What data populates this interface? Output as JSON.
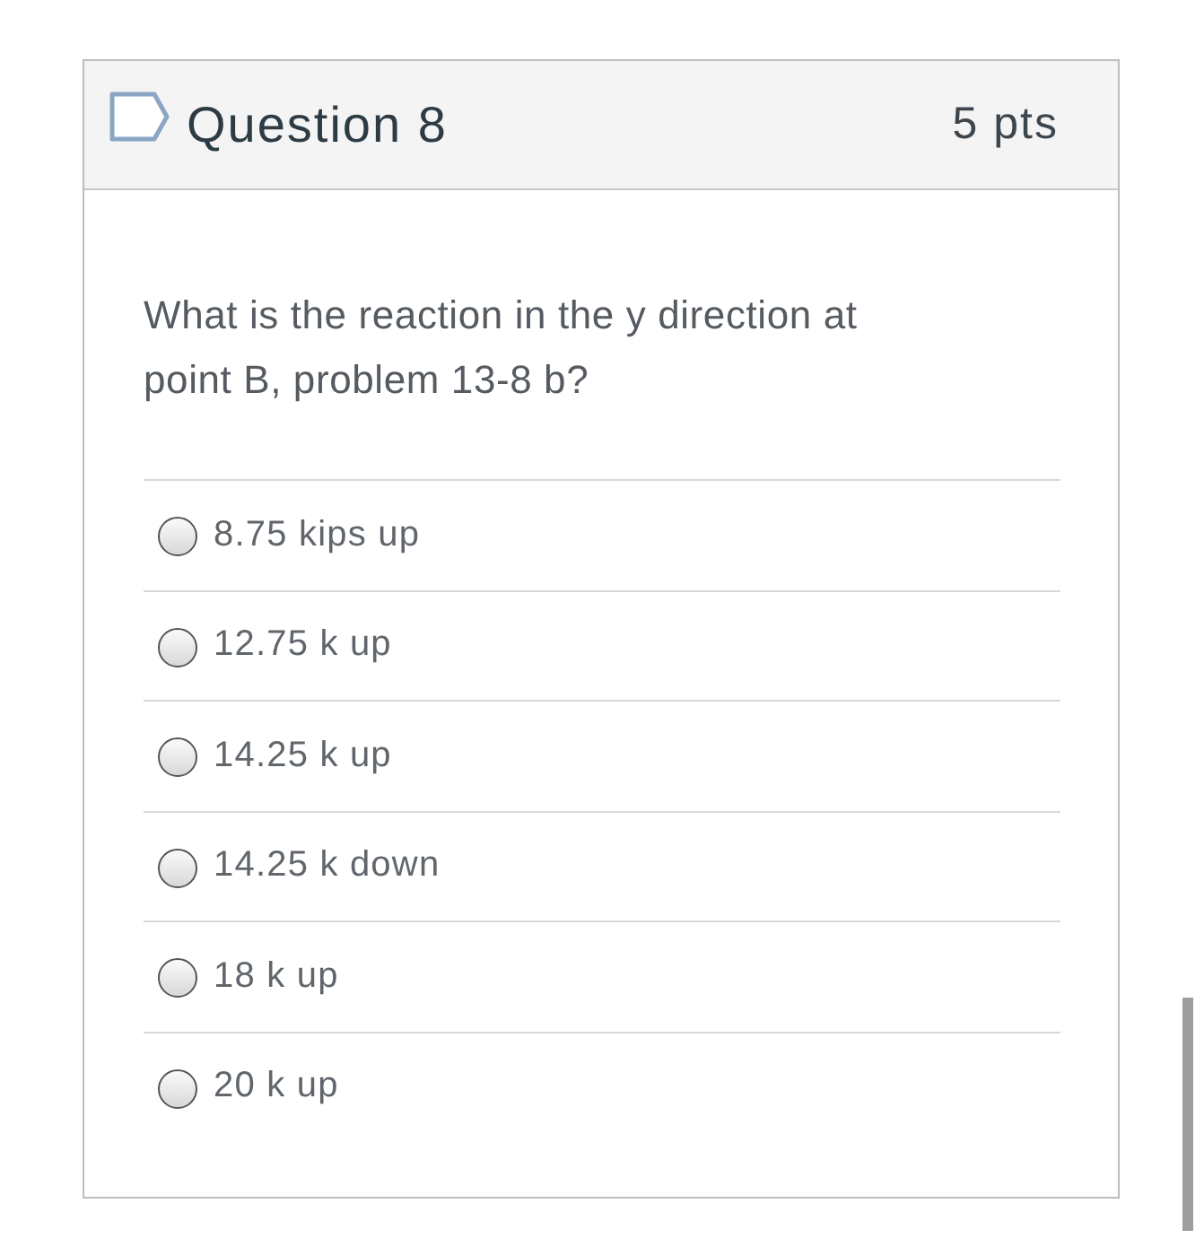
{
  "question": {
    "flagged": false,
    "title": "Question 8",
    "points": "5 pts",
    "text": "What is the reaction in the y direction at point B, problem 13-8 b?"
  },
  "answers": [
    {
      "label": "8.75 kips up",
      "selected": false
    },
    {
      "label": "12.75 k up",
      "selected": false
    },
    {
      "label": "14.25 k up",
      "selected": false
    },
    {
      "label": "14.25 k down",
      "selected": false
    },
    {
      "label": "18 k up",
      "selected": false
    },
    {
      "label": "20 k up",
      "selected": false
    }
  ]
}
